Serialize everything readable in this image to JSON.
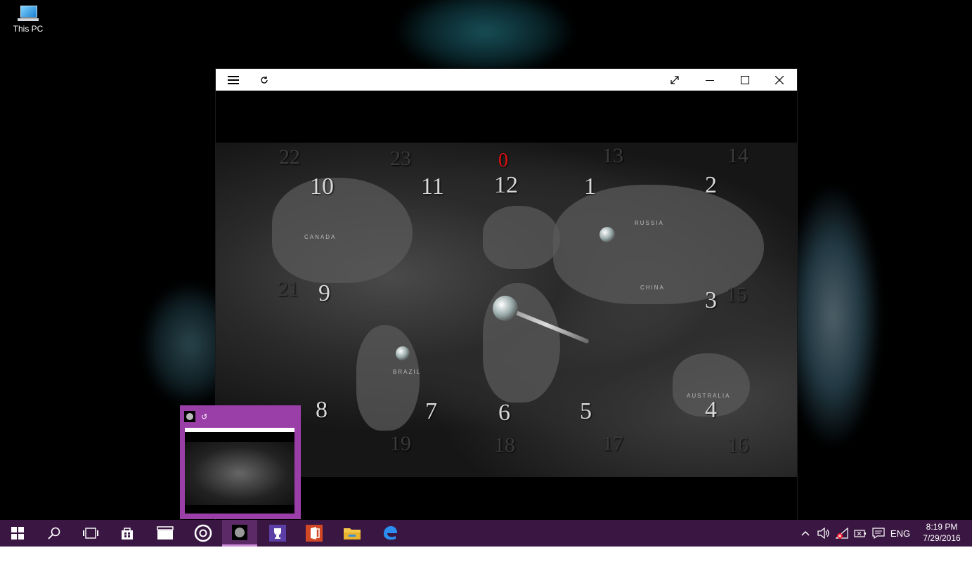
{
  "desktop": {
    "icons": [
      {
        "label": "This PC",
        "icon": "computer-icon"
      }
    ]
  },
  "window": {
    "titlebar": {
      "menu_icon": "hamburger-menu-icon",
      "refresh_icon": "refresh-icon",
      "controls": [
        "fullscreen-icon",
        "minimize-icon",
        "maximize-icon",
        "close-icon"
      ]
    },
    "map": {
      "hour_labels_top": [
        "10",
        "11",
        "12",
        "1",
        "2"
      ],
      "hour_labels_bottom": [
        "8",
        "7",
        "6",
        "5",
        "4"
      ],
      "hour_labels_side": [
        "9",
        "3"
      ],
      "dim_labels_top": [
        "22",
        "23",
        "13",
        "14"
      ],
      "dim_labels_side": [
        "21",
        "15"
      ],
      "dim_labels_bottom": [
        "19",
        "18",
        "17",
        "16"
      ],
      "red_label": "0",
      "countries": [
        "CANADA",
        "RUSSIA",
        "CHINA",
        "BRAZIL",
        "AUSTRALIA"
      ]
    }
  },
  "preview": {
    "app_icon": "world-clock-icon",
    "refresh_icon": "refresh-icon"
  },
  "taskbar": {
    "items": [
      "windows-start-icon",
      "search-icon",
      "task-view-icon",
      "store-icon",
      "movies-tv-icon",
      "groove-icon",
      "world-clock-app-icon",
      "trophy-app-icon",
      "office-icon",
      "file-explorer-icon",
      "edge-icon"
    ],
    "tray": {
      "language": "ENG",
      "time": "8:19 PM",
      "date": "7/29/2016"
    }
  }
}
